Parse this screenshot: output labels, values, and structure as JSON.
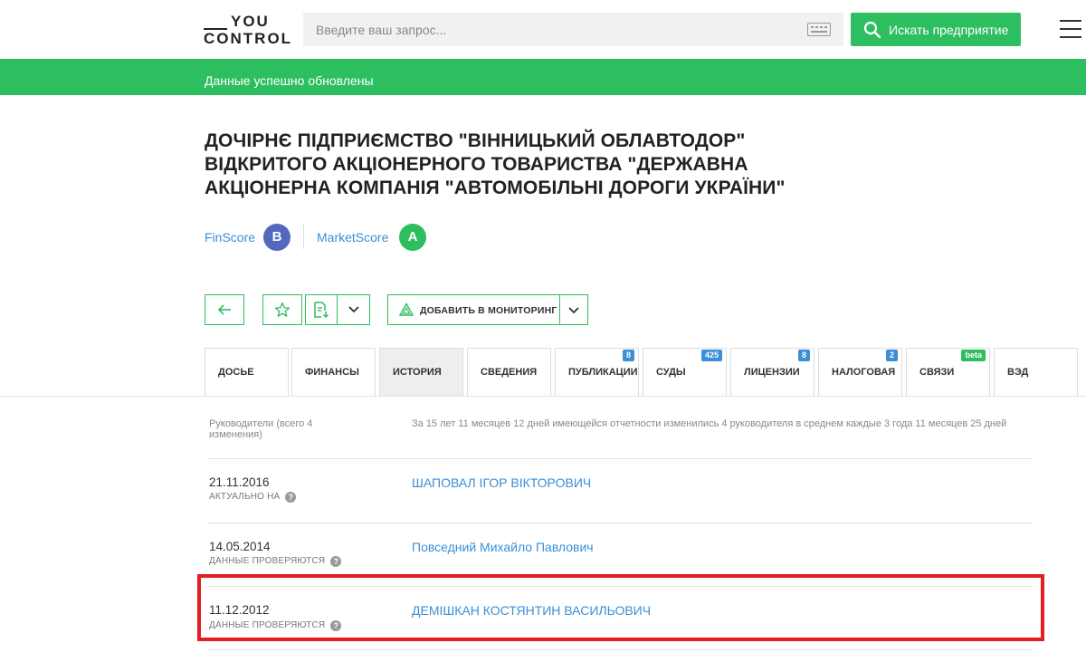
{
  "header": {
    "logo_line1": "YOU",
    "logo_line2": "CONTROL",
    "search_placeholder": "Введите ваш запрос...",
    "search_button": "Искать предприятие",
    "accent": "#2dbe60"
  },
  "notice": {
    "text": "Данные успешно обновлены"
  },
  "company": {
    "title": "ДОЧІРНЄ ПІДПРИЄМСТВО \"ВІННИЦЬКИЙ ОБЛАВТОДОР\" ВІДКРИТОГО АКЦІОНЕРНОГО ТОВАРИСТВА \"ДЕРЖАВНА АКЦІОНЕРНА КОМПАНІЯ \"АВТОМОБІЛЬНІ ДОРОГИ УКРАЇНИ\""
  },
  "scores": {
    "finscore_label": "FinScore",
    "finscore_value": "B",
    "finscore_color": "#5468c0",
    "marketscore_label": "MarketScore",
    "marketscore_value": "A",
    "marketscore_color": "#2dbe60"
  },
  "actions": {
    "monitor_label": "ДОБАВИТЬ В МОНИТОРИНГ"
  },
  "tabs": [
    {
      "label": "ДОСЬЕ",
      "count": ""
    },
    {
      "label": "ФИНАНСЫ",
      "count": ""
    },
    {
      "label": "ИСТОРИЯ",
      "count": "",
      "active": true
    },
    {
      "label": "СВЕДЕНИЯ",
      "count": ""
    },
    {
      "label": "ПУБЛИКАЦИИ",
      "count": "8"
    },
    {
      "label": "СУДЫ",
      "count": "425"
    },
    {
      "label": "ЛИЦЕНЗИИ",
      "count": "8"
    },
    {
      "label": "НАЛОГОВАЯ",
      "count": "2"
    },
    {
      "label": "СВЯЗИ",
      "count": "beta"
    },
    {
      "label": "ВЭД",
      "count": ""
    }
  ],
  "history": {
    "section_label": "Руководители (всего 4 изменения)",
    "summary": "За 15 лет 11 месяцев 12 дней имеющейся отчетности изменились 4 руководителя в среднем каждые 3 года 11 месяцев 25 дней",
    "rows": [
      {
        "date": "21.11.2016",
        "status": "АКТУАЛЬНО НА",
        "name": "ШАПОВАЛ ІГОР ВІКТОРОВИЧ"
      },
      {
        "date": "14.05.2014",
        "status": "ДАННЫЕ ПРОВЕРЯЮТСЯ",
        "name": "Повседний Михайло Павлович"
      },
      {
        "date": "11.12.2012",
        "status": "ДАННЫЕ ПРОВЕРЯЮТСЯ",
        "name": "ДЕМІШКАН КОСТЯНТИН ВАСИЛЬОВИЧ"
      }
    ],
    "question_mark": "?"
  }
}
